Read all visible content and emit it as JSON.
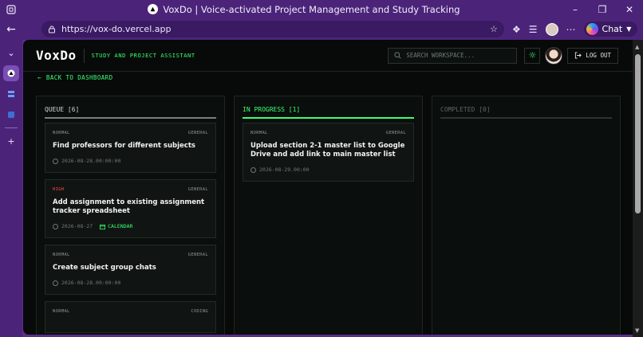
{
  "browser": {
    "window_title": "VoxDo | Voice-activated Project Management and Study Tracking",
    "url": "https://vox-do.vercel.app",
    "chat_label": "Chat"
  },
  "app": {
    "brand": "VoxDo",
    "tagline": "STUDY AND PROJECT ASSISTANT",
    "search_placeholder": "SEARCH WORKSPACE...",
    "logout_label": "LOG OUT",
    "back_label": "BACK TO DASHBOARD"
  },
  "columns": [
    {
      "title": "QUEUE [6]",
      "cards": [
        {
          "priority": "NORMAL",
          "category": "GENERAL",
          "title": "Find professors for different subjects",
          "date": "2026-08-28.00:00:00"
        },
        {
          "priority": "HIGH",
          "category": "GENERAL",
          "title": "Add assignment to existing assignment tracker spreadsheet",
          "date": "2026-08-27",
          "tag": "CALENDAR"
        },
        {
          "priority": "NORMAL",
          "category": "GENERAL",
          "title": "Create subject group chats",
          "date": "2026-08-28.00:00:00"
        },
        {
          "priority": "NORMAL",
          "category": "CODING"
        }
      ]
    },
    {
      "title": "IN PROGRESS [1]",
      "cards": [
        {
          "priority": "NORMAL",
          "category": "GENERAL",
          "title": "Upload section 2-1 master list to Google Drive and add link to main master list",
          "date": "2026-08-29.00:00"
        }
      ]
    },
    {
      "title": "COMPLETED [0]",
      "cards": []
    }
  ],
  "colors": {
    "accent": "#3dff72",
    "high_priority": "#ff4747",
    "background": "#070a09",
    "browser_frame": "#4b2479"
  }
}
